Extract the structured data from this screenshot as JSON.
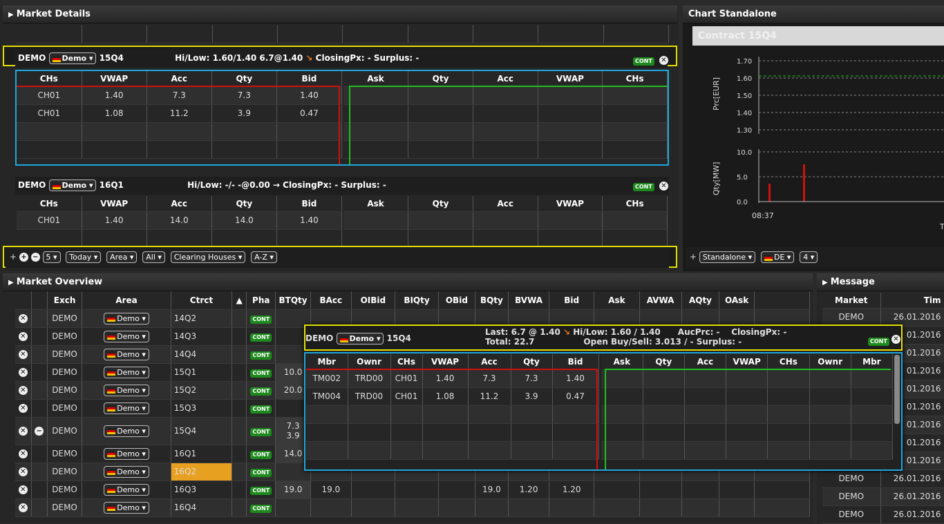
{
  "market_details": {
    "title": "Market Details",
    "c1": {
      "exch": "DEMO",
      "area": "Demo ▾",
      "ctrct": "15Q4",
      "info": "Hi/Low: 1.60/1.40   6.7@1.40",
      "info2": "ClosingPx: - Surplus: -",
      "phase": "CONT",
      "bid_headers": [
        "CHs",
        "VWAP",
        "Acc",
        "Qty",
        "Bid"
      ],
      "ask_headers": [
        "Ask",
        "Qty",
        "Acc",
        "VWAP",
        "CHs"
      ],
      "bids": [
        [
          "CH01",
          "1.40",
          "7.3",
          "7.3",
          "1.40"
        ],
        [
          "CH01",
          "1.08",
          "11.2",
          "3.9",
          "0.47"
        ]
      ]
    },
    "c2": {
      "exch": "DEMO",
      "area": "Demo ▾",
      "ctrct": "16Q1",
      "info": "Hi/Low: -/-  -@0.00",
      "info2": "ClosingPx: - Surplus: -",
      "phase": "CONT",
      "bid_headers": [
        "CHs",
        "VWAP",
        "Acc",
        "Qty",
        "Bid"
      ],
      "ask_headers": [
        "Ask",
        "Qty",
        "Acc",
        "VWAP",
        "CHs"
      ],
      "bids": [
        [
          "CH01",
          "1.40",
          "14.0",
          "14.0",
          "1.40"
        ]
      ]
    },
    "toolbar": {
      "depth": "5 ▾",
      "today": "Today ▾",
      "area": "Area ▾",
      "all": "All ▾",
      "ch": "Clearing Houses ▾",
      "az": "A-Z ▾"
    }
  },
  "chart": {
    "title": "Chart Standalone",
    "contract": "Contract 15Q4",
    "ylabel_price": "Prc[EUR]",
    "ylabel_qty": "Qty[MW]",
    "price_ticks": [
      "1.70",
      "1.60",
      "1.50",
      "1.40",
      "1.30"
    ],
    "qty_ticks": [
      "10.0",
      "5.0",
      "0.0"
    ],
    "time_label": "08:37",
    "toolbar": {
      "mode": "Standalone ▾",
      "area": "DE ▾",
      "n": "4 ▾"
    }
  },
  "overview": {
    "title": "Market Overview",
    "headers": [
      "Exch",
      "Area",
      "Ctrct",
      "▲",
      "Pha",
      "BTQty",
      "BAcc",
      "OIBid",
      "BIQty",
      "OBid",
      "BQty",
      "BVWA",
      "Bid",
      "Ask",
      "AVWA",
      "AQty",
      "OAsk"
    ],
    "rows": [
      {
        "exch": "DEMO",
        "ctrct": "14Q2",
        "pha": "CONT",
        "btqty": "",
        "bacc": "",
        "bqty": "",
        "bvwa": "",
        "bid": ""
      },
      {
        "exch": "DEMO",
        "ctrct": "14Q3",
        "pha": "CONT",
        "btqty": "",
        "bacc": "",
        "bqty": "",
        "bvwa": "",
        "bid": ""
      },
      {
        "exch": "DEMO",
        "ctrct": "14Q4",
        "pha": "CONT",
        "btqty": "",
        "bacc": "",
        "bqty": "",
        "bvwa": "",
        "bid": ""
      },
      {
        "exch": "DEMO",
        "ctrct": "15Q1",
        "pha": "CONT",
        "btqty": "10.0",
        "bacc": "",
        "bqty": "",
        "bvwa": "",
        "bid": ""
      },
      {
        "exch": "DEMO",
        "ctrct": "15Q2",
        "pha": "CONT",
        "btqty": "20.0",
        "bacc": "",
        "bqty": "",
        "bvwa": "",
        "bid": ""
      },
      {
        "exch": "DEMO",
        "ctrct": "15Q3",
        "pha": "CONT",
        "btqty": "",
        "bacc": "",
        "bqty": "",
        "bvwa": "",
        "bid": ""
      },
      {
        "exch": "DEMO",
        "ctrct": "15Q4",
        "pha": "CONT",
        "btqty": "7.3",
        "btqty2": "3.9",
        "bacc": "",
        "bqty": "",
        "bvwa": "",
        "bid": ""
      },
      {
        "exch": "DEMO",
        "ctrct": "16Q1",
        "pha": "CONT",
        "btqty": "14.0",
        "bacc": "",
        "bqty": "",
        "bvwa": "",
        "bid": ""
      },
      {
        "exch": "DEMO",
        "ctrct": "16Q2",
        "pha": "CONT",
        "btqty": "",
        "bacc": "",
        "bqty": "",
        "bvwa": "",
        "bid": ""
      },
      {
        "exch": "DEMO",
        "ctrct": "16Q3",
        "pha": "CONT",
        "btqty": "19.0",
        "bacc": "19.0",
        "bqty": "19.0",
        "bvwa": "1.20",
        "bid": "1.20"
      },
      {
        "exch": "DEMO",
        "ctrct": "16Q4",
        "pha": "CONT",
        "btqty": "",
        "bacc": "",
        "bqty": "",
        "bvwa": "",
        "bid": ""
      }
    ],
    "area_label": "Demo ▾"
  },
  "popup": {
    "exch": "DEMO",
    "area": "Demo ▾",
    "ctrct": "15Q4",
    "last": "Last: 6.7 @ 1.40",
    "hilo": "Hi/Low: 1.60 / 1.40",
    "aucprc": "AucPrc: -",
    "closing": "ClosingPx: -",
    "total": "Total: 22.7",
    "openbs": "Open Buy/Sell: 3.013 / -  Surplus: -",
    "phase": "CONT",
    "bid_headers": [
      "Mbr",
      "Ownr",
      "CHs",
      "VWAP",
      "Acc",
      "Qty",
      "Bid"
    ],
    "ask_headers": [
      "Ask",
      "Qty",
      "Acc",
      "VWAP",
      "CHs",
      "Ownr",
      "Mbr"
    ],
    "bids": [
      [
        "TM002",
        "TRD00",
        "CH01",
        "1.40",
        "7.3",
        "7.3",
        "1.40"
      ],
      [
        "TM004",
        "TRD00",
        "CH01",
        "1.08",
        "11.2",
        "3.9",
        "0.47"
      ]
    ]
  },
  "message": {
    "title": "Message",
    "headers": [
      "Market",
      "Tim"
    ],
    "rows": [
      [
        "DEMO",
        "26.01.2016"
      ],
      [
        "",
        "01.2016"
      ],
      [
        "",
        "01.2016"
      ],
      [
        "",
        "01.2016"
      ],
      [
        "",
        "01.2016"
      ],
      [
        "",
        "01.2016"
      ],
      [
        "",
        "01.2016"
      ],
      [
        "",
        "01.2016"
      ],
      [
        "",
        "01.2016"
      ],
      [
        "DEMO",
        "26.01.2016"
      ],
      [
        "DEMO",
        "26.01.2016"
      ],
      [
        "DEMO",
        "26.01.2016"
      ]
    ]
  }
}
